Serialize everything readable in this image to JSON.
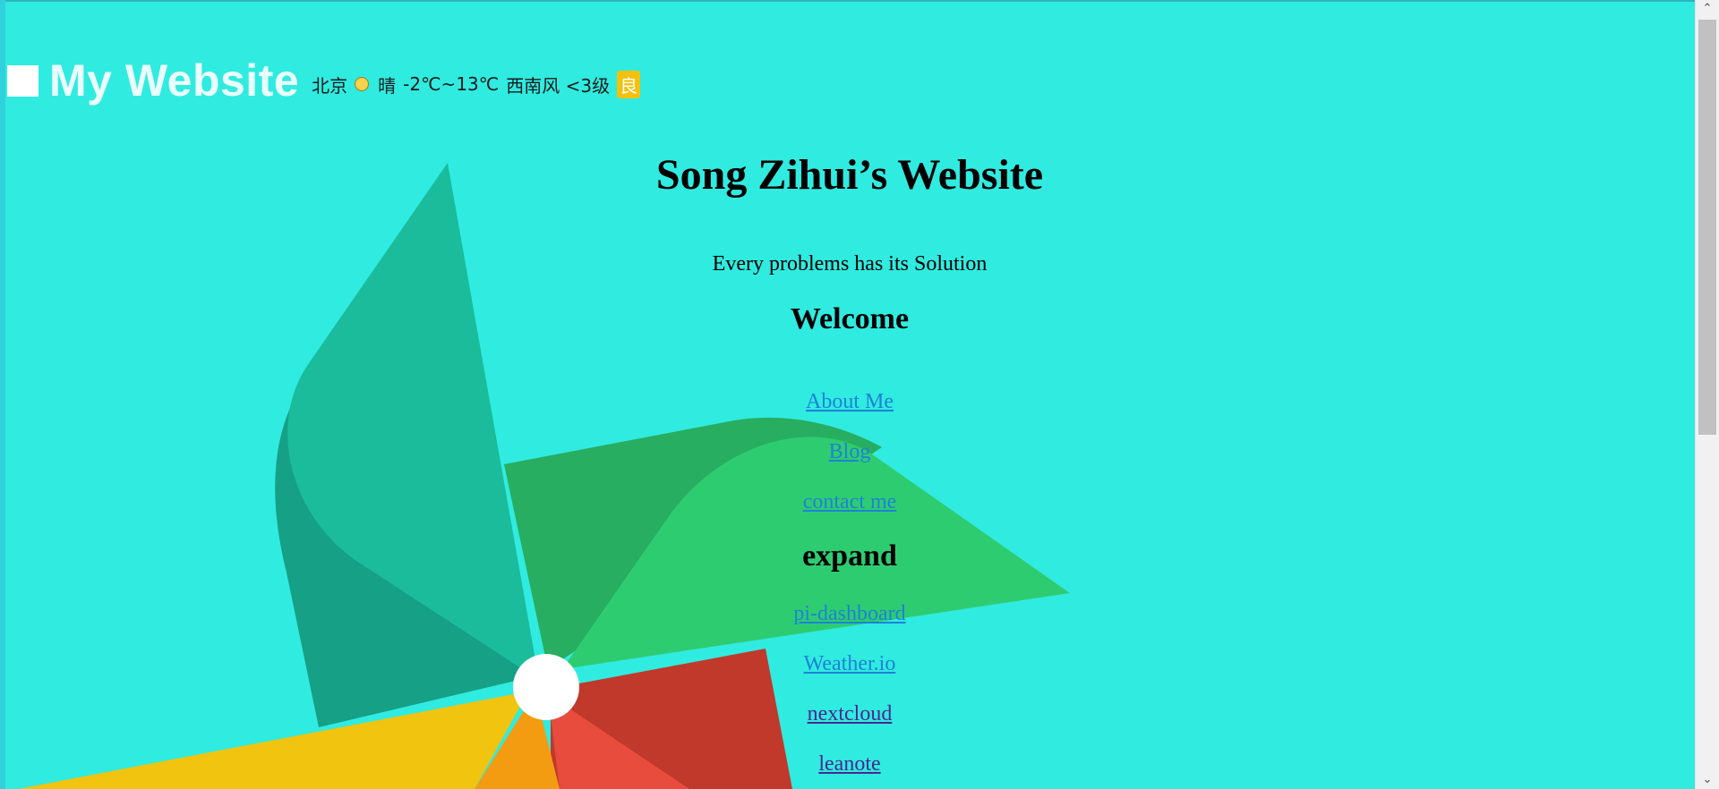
{
  "header": {
    "site_name": "My Website",
    "weather": {
      "city": "北京",
      "icon": "sun-icon",
      "condition": "晴",
      "temperature": "-2℃~13℃",
      "wind": "西南风 <3级",
      "air_quality": "良"
    }
  },
  "main": {
    "title": "Song Zihui’s Website",
    "tagline": "Every problems has its Solution",
    "welcome_heading": "Welcome",
    "welcome_links": [
      {
        "label": "About Me"
      },
      {
        "label": "Blog"
      },
      {
        "label": "contact me"
      }
    ],
    "expand_heading": "expand",
    "expand_links": [
      {
        "label": "pi-dashboard"
      },
      {
        "label": "Weather.io"
      },
      {
        "label": "nextcloud"
      },
      {
        "label": "leanote"
      }
    ]
  },
  "colors": {
    "background": "#30ebe0",
    "link": "#1e82d6",
    "link_visited": "#4a2890",
    "aqi_badge": "#f4c10e"
  }
}
